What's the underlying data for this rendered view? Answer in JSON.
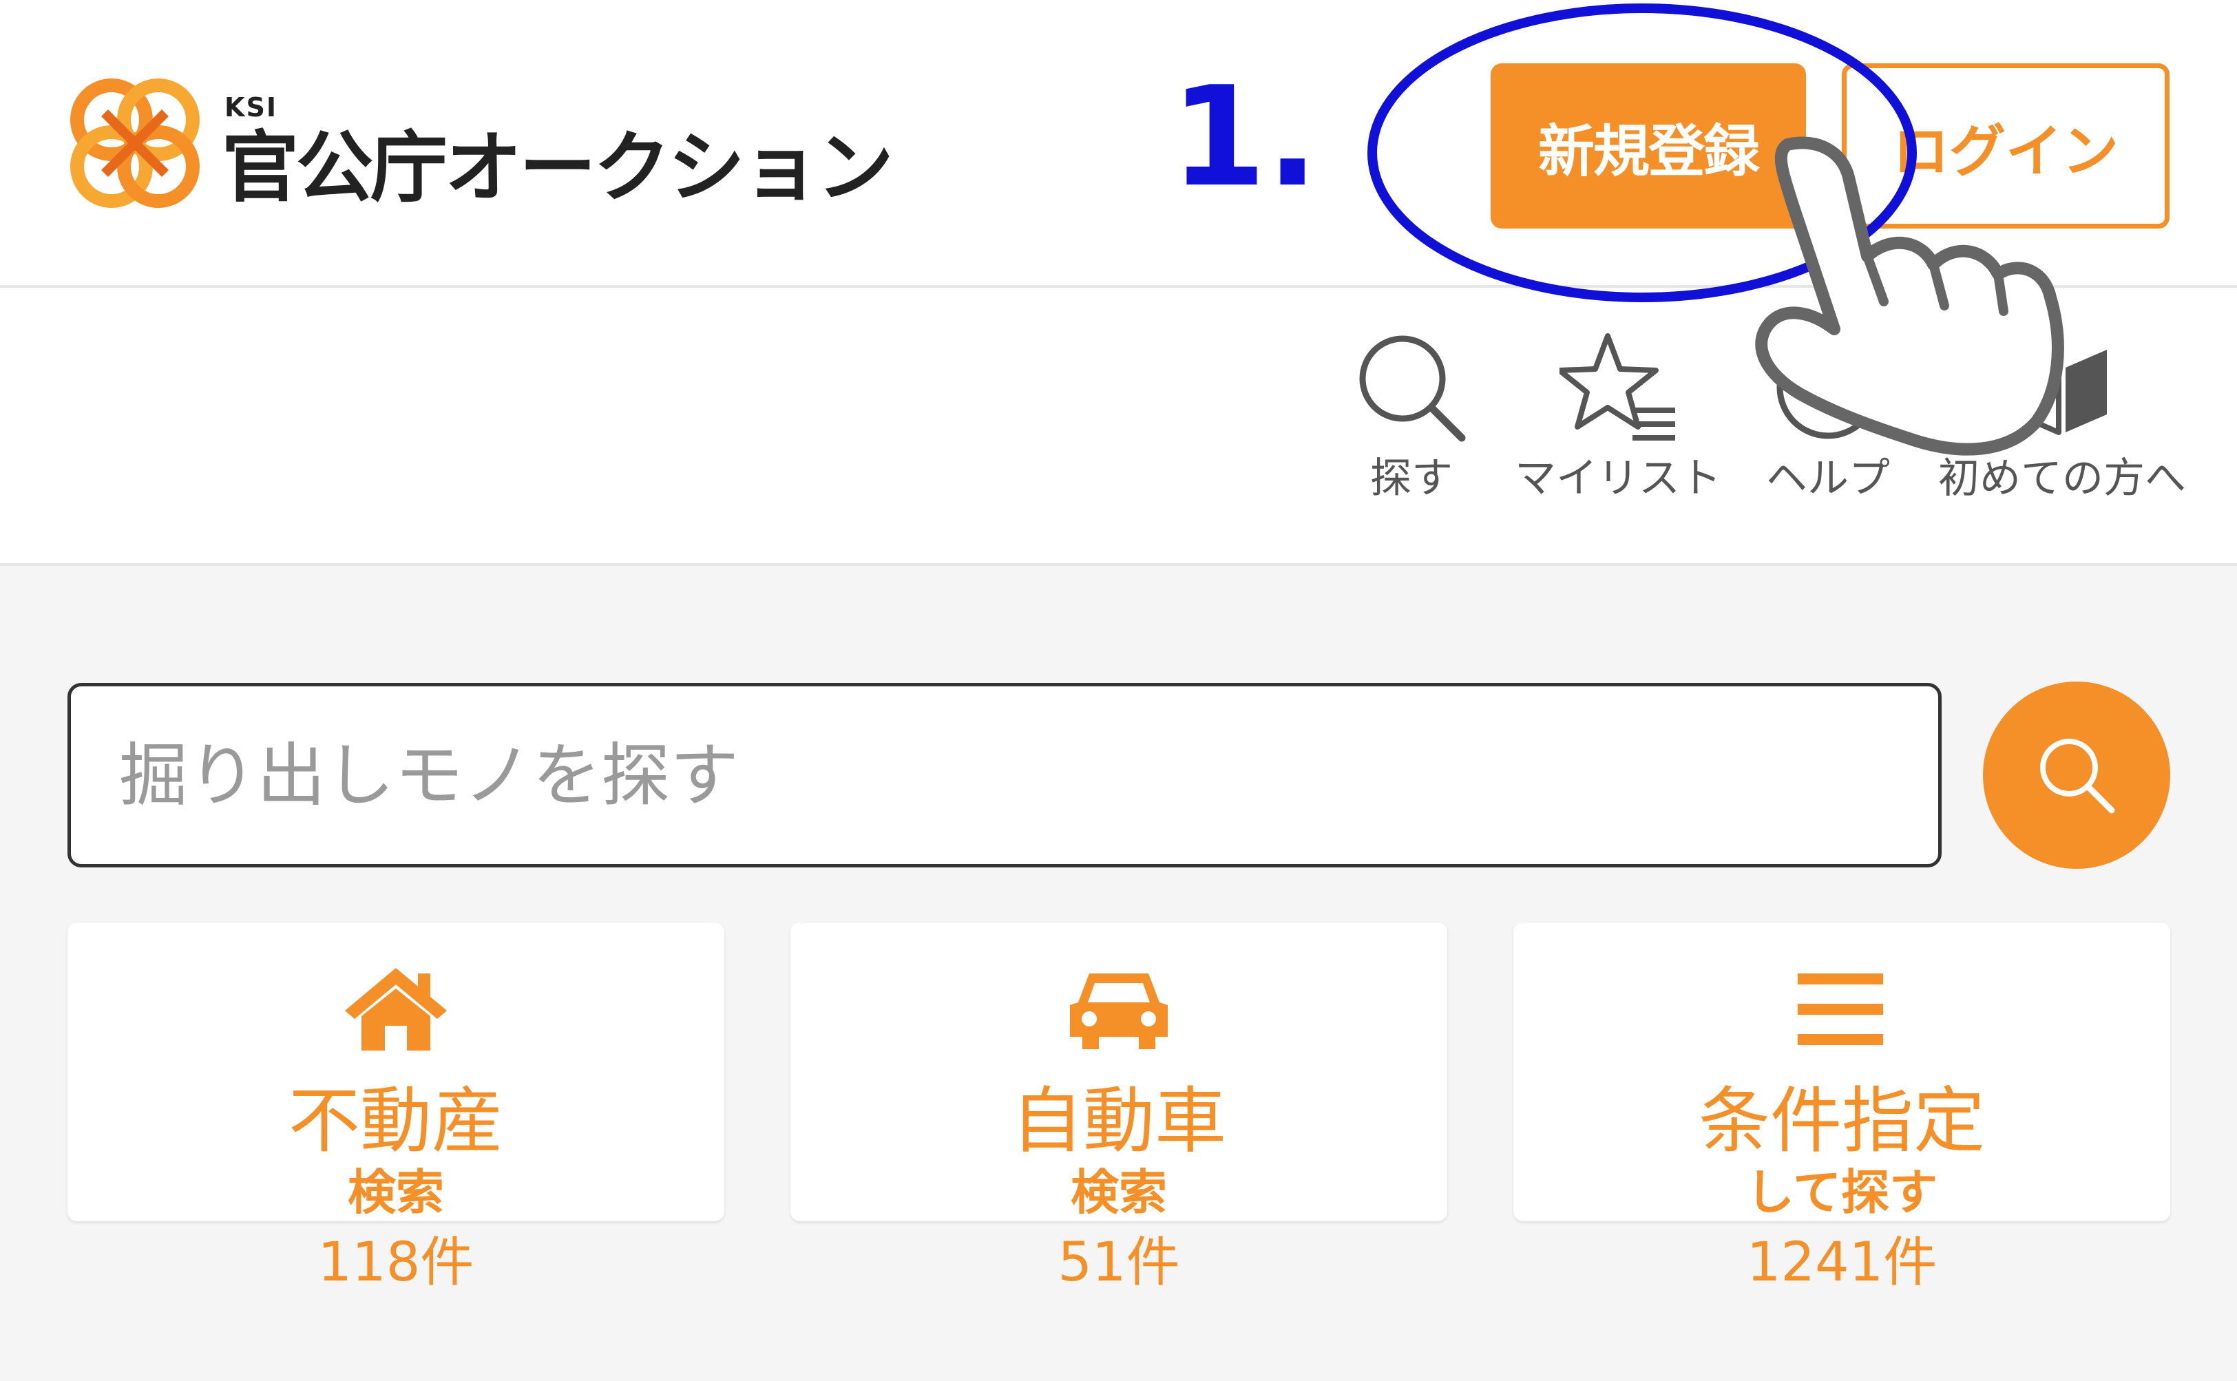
{
  "header": {
    "logo_small": "KSI",
    "logo_name": "官公庁オークション",
    "register_label": "新規登録",
    "login_label": "ログイン"
  },
  "annotation": {
    "step_label": "1."
  },
  "nav": {
    "items": [
      {
        "label": "探す",
        "icon": "search-icon"
      },
      {
        "label": "マイリスト",
        "icon": "star-list-icon"
      },
      {
        "label": "ヘルプ",
        "icon": "help-icon"
      },
      {
        "label": "初めての方へ",
        "icon": "book-icon"
      }
    ]
  },
  "search": {
    "placeholder": "掘り出しモノを探す"
  },
  "cards": [
    {
      "title": "不動産",
      "sub": "検索",
      "count": "118件",
      "icon": "house-icon"
    },
    {
      "title": "自動車",
      "sub": "検索",
      "count": "51件",
      "icon": "car-icon"
    },
    {
      "title": "条件指定",
      "sub": "して探す",
      "count": "1241件",
      "icon": "menu-lines-icon"
    }
  ],
  "colors": {
    "accent": "#f58f28",
    "annotation": "#1010d8",
    "text_dark": "#222222",
    "background": "#f5f5f5"
  }
}
